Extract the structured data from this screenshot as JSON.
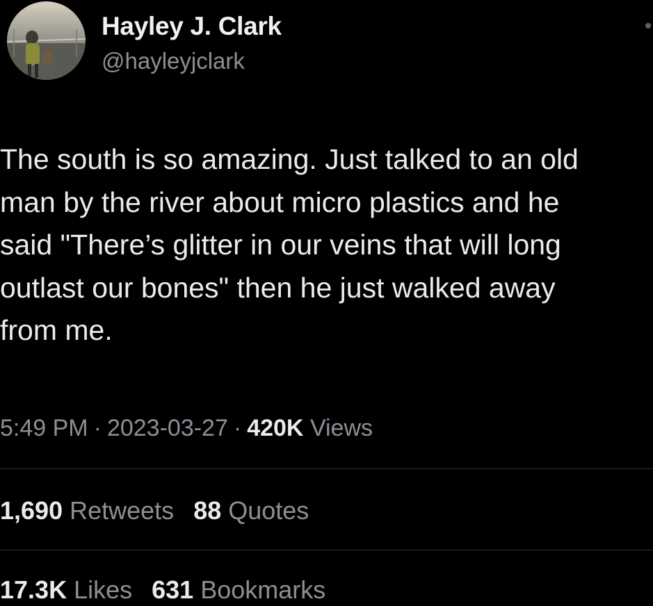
{
  "author": {
    "display_name": "Hayley J. Clark",
    "handle": "@hayleyjclark",
    "avatar_icon": "profile-photo"
  },
  "tweet": {
    "lines": [
      "The south is so amazing. Just talked to an old",
      "man by the river about micro plastics and he",
      "said \"There’s glitter in our veins that will long",
      "outlast our bones\" then he just walked away",
      "from me."
    ]
  },
  "meta": {
    "time": "5:49 PM",
    "separator": "·",
    "date": "2023-03-27",
    "views_count": "420K",
    "views_label": "Views"
  },
  "stats": {
    "retweets_count": "1,690",
    "retweets_label": "Retweets",
    "quotes_count": "88",
    "quotes_label": "Quotes",
    "likes_count": "17.3K",
    "likes_label": "Likes",
    "bookmarks_count": "631",
    "bookmarks_label": "Bookmarks"
  },
  "colors": {
    "background": "#000000",
    "primary_text": "#ebebeb",
    "secondary_text": "#8b9096",
    "divider": "#2f3336"
  }
}
